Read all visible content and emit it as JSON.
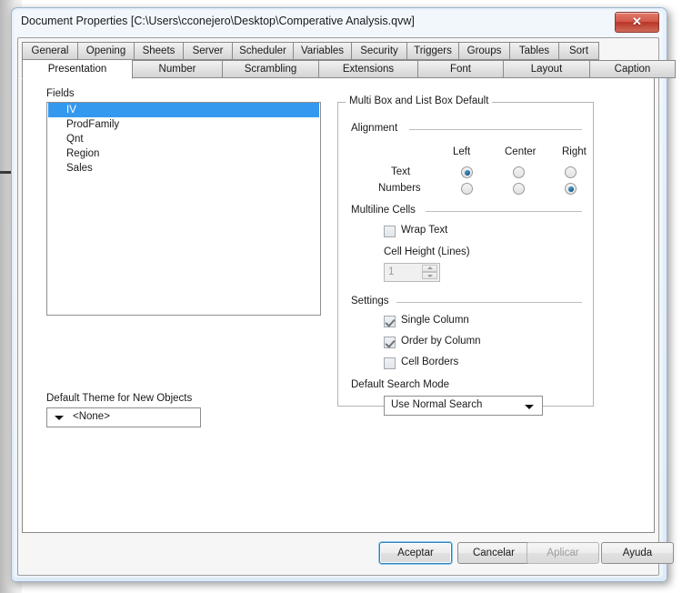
{
  "window": {
    "title": "Document Properties [C:\\Users\\cconejero\\Desktop\\Comperative Analysis.qvw]",
    "close_label": "✕"
  },
  "tabs": {
    "row1": [
      {
        "label": "General",
        "active": false
      },
      {
        "label": "Opening",
        "active": false
      },
      {
        "label": "Sheets",
        "active": false
      },
      {
        "label": "Server",
        "active": false
      },
      {
        "label": "Scheduler",
        "active": false
      },
      {
        "label": "Variables",
        "active": false
      },
      {
        "label": "Security",
        "active": false
      },
      {
        "label": "Triggers",
        "active": false
      },
      {
        "label": "Groups",
        "active": false
      },
      {
        "label": "Tables",
        "active": false
      },
      {
        "label": "Sort",
        "active": false
      }
    ],
    "row2": [
      {
        "label": "Presentation",
        "active": true
      },
      {
        "label": "Number",
        "active": false
      },
      {
        "label": "Scrambling",
        "active": false
      },
      {
        "label": "Extensions",
        "active": false
      },
      {
        "label": "Font",
        "active": false
      },
      {
        "label": "Layout",
        "active": false
      },
      {
        "label": "Caption",
        "active": false
      }
    ]
  },
  "fields": {
    "label": "Fields",
    "items": [
      {
        "name": "IV",
        "selected": true
      },
      {
        "name": "ProdFamily",
        "selected": false
      },
      {
        "name": "Qnt",
        "selected": false
      },
      {
        "name": "Region",
        "selected": false
      },
      {
        "name": "Sales",
        "selected": false
      }
    ],
    "selection_color": "#3399ee"
  },
  "theme": {
    "label": "Default Theme for New Objects",
    "value": "<None>"
  },
  "multibox_group": {
    "title": "Multi Box and List Box Default",
    "alignment": {
      "title": "Alignment",
      "columns": [
        "Left",
        "Center",
        "Right"
      ],
      "rows": [
        {
          "label": "Text",
          "selected": "Left"
        },
        {
          "label": "Numbers",
          "selected": "Right"
        }
      ]
    },
    "multiline": {
      "title": "Multiline Cells",
      "wrap_text": {
        "label": "Wrap Text",
        "checked": false
      },
      "cell_height": {
        "label": "Cell Height (Lines)",
        "value": "1",
        "enabled": false
      }
    },
    "settings": {
      "title": "Settings",
      "checkboxes": [
        {
          "label": "Single Column",
          "checked": true
        },
        {
          "label": "Order by Column",
          "checked": true
        },
        {
          "label": "Cell Borders",
          "checked": false
        }
      ],
      "search_mode": {
        "label": "Default Search Mode",
        "value": "Use Normal Search"
      }
    }
  },
  "footer": {
    "ok": "Aceptar",
    "cancel": "Cancelar",
    "apply": "Aplicar",
    "help": "Ayuda"
  }
}
